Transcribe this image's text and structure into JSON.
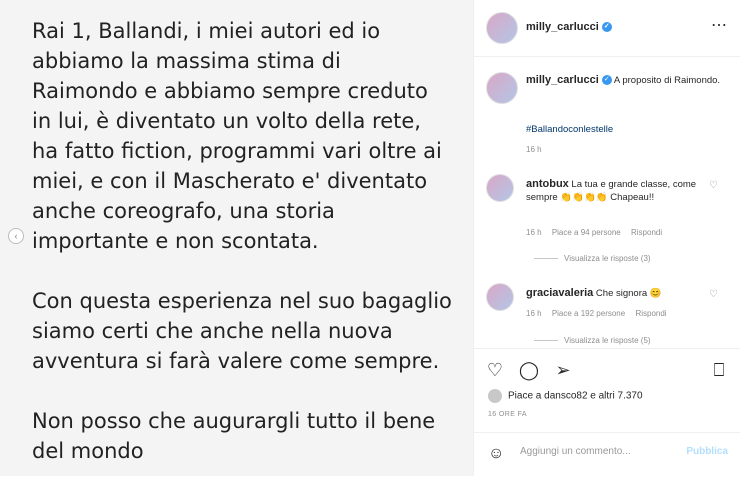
{
  "post": {
    "paragraphs": [
      "Rai 1, Ballandi, i miei autori ed io abbiamo la massima stima di Raimondo  e abbiamo sempre creduto in lui, è diventato un volto della rete, ha fatto fiction, programmi vari oltre ai miei, e con il Mascherato e' diventato anche coreografo, una storia importante e non scontata.",
      "Con questa esperienza nel suo bagaglio siamo certi che anche nella nuova avventura si farà valere come sempre.",
      "Non posso che augurargli tutto il bene del mondo"
    ]
  },
  "header": {
    "username": "milly_carlucci"
  },
  "caption": {
    "username": "milly_carlucci",
    "text": "A proposito di Raimondo.",
    "hashtag": "#Ballandoconlestelle",
    "time": "16 h"
  },
  "comments": [
    {
      "username": "antobux",
      "text": "La tua e grande classe, come sempre 👏👏👏👏 Chapeau!!",
      "time": "16 h",
      "likes": "Piace a 94 persone",
      "reply": "Rispondi",
      "replies": "Visualizza le risposte (3)"
    },
    {
      "username": "graciavaleria",
      "text": "Che signora 😊",
      "time": "16 h",
      "likes": "Piace a 192 persone",
      "reply": "Rispondi",
      "replies": "Visualizza le risposte (5)"
    }
  ],
  "likes_text": "Piace a dansco82 e altri 7.370",
  "date": "16 ORE FA",
  "add_comment": {
    "placeholder": "Aggiungi un commento...",
    "publish": "Pubblica"
  },
  "icons": {
    "verified": "verified-badge-icon",
    "more": "more-options-icon",
    "heart": "heart-icon",
    "comment": "comment-icon",
    "share": "share-icon",
    "bookmark": "bookmark-icon",
    "emoji": "emoji-icon"
  },
  "colors": {
    "accent": "#3897f0",
    "hashtag": "#00376b",
    "publish": "#b2dffc"
  }
}
